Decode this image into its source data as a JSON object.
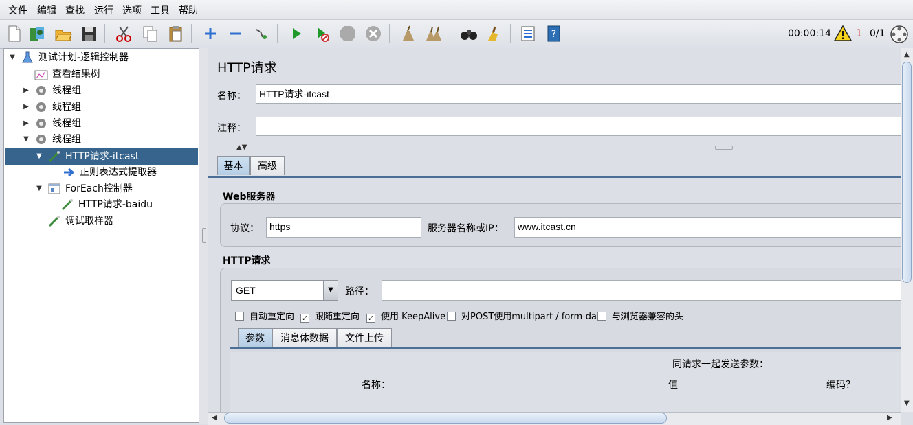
{
  "menu": [
    "文件",
    "编辑",
    "查找",
    "运行",
    "选项",
    "工具",
    "帮助"
  ],
  "toolbar": {
    "icons": [
      "new-icon",
      "templates-icon",
      "open-icon",
      "save-icon",
      "cut-icon",
      "copy-icon",
      "paste-icon",
      "expand-icon",
      "collapse-icon",
      "toggle-icon",
      "start-icon",
      "start-no-pause-icon",
      "stop-icon",
      "shutdown-icon",
      "clear-icon",
      "clear-all-icon",
      "search-icon",
      "reset-search-icon",
      "function-helper-icon",
      "help-icon"
    ],
    "timer": "00:00:14",
    "warning_count": "1",
    "threads": "0/1"
  },
  "tree": {
    "items": [
      {
        "label": "测试计划-逻辑控制器",
        "icon": "test-plan-icon",
        "expanded": true
      },
      {
        "label": "查看结果树",
        "icon": "listener-icon"
      },
      {
        "label": "线程组",
        "icon": "thread-group-icon",
        "expanded": false
      },
      {
        "label": "线程组",
        "icon": "thread-group-icon",
        "expanded": false
      },
      {
        "label": "线程组",
        "icon": "thread-group-icon",
        "expanded": false
      },
      {
        "label": "线程组",
        "icon": "thread-group-icon",
        "expanded": true
      },
      {
        "label": "HTTP请求-itcast",
        "icon": "sampler-icon",
        "expanded": true,
        "selected": true
      },
      {
        "label": "正则表达式提取器",
        "icon": "extractor-icon"
      },
      {
        "label": "ForEach控制器",
        "icon": "controller-icon",
        "expanded": true
      },
      {
        "label": "HTTP请求-baidu",
        "icon": "sampler-icon"
      },
      {
        "label": "调试取样器",
        "icon": "sampler-icon"
      }
    ]
  },
  "panel": {
    "title": "HTTP请求",
    "name_label": "名称：",
    "name_value": "HTTP请求-itcast",
    "comment_label": "注释：",
    "comment_value": "",
    "tabs": [
      "基本",
      "高级"
    ],
    "web_server": {
      "title": "Web服务器",
      "protocol_label": "协议：",
      "protocol_value": "https",
      "server_label": "服务器名称或IP：",
      "server_value": "www.itcast.cn"
    },
    "http_request": {
      "title": "HTTP请求",
      "method": "GET",
      "path_label": "路径：",
      "path_value": "",
      "options": [
        {
          "label": "自动重定向",
          "checked": false
        },
        {
          "label": "跟随重定向",
          "checked": true
        },
        {
          "label": "使用 KeepAlive",
          "checked": true
        },
        {
          "label": "对POST使用multipart / form-data",
          "checked": false
        },
        {
          "label": "与浏览器兼容的头",
          "checked": false
        }
      ],
      "subtabs": [
        "参数",
        "消息体数据",
        "文件上传"
      ],
      "params_caption": "同请求一起发送参数：",
      "columns": [
        "名称：",
        "值",
        "编码？"
      ]
    }
  }
}
